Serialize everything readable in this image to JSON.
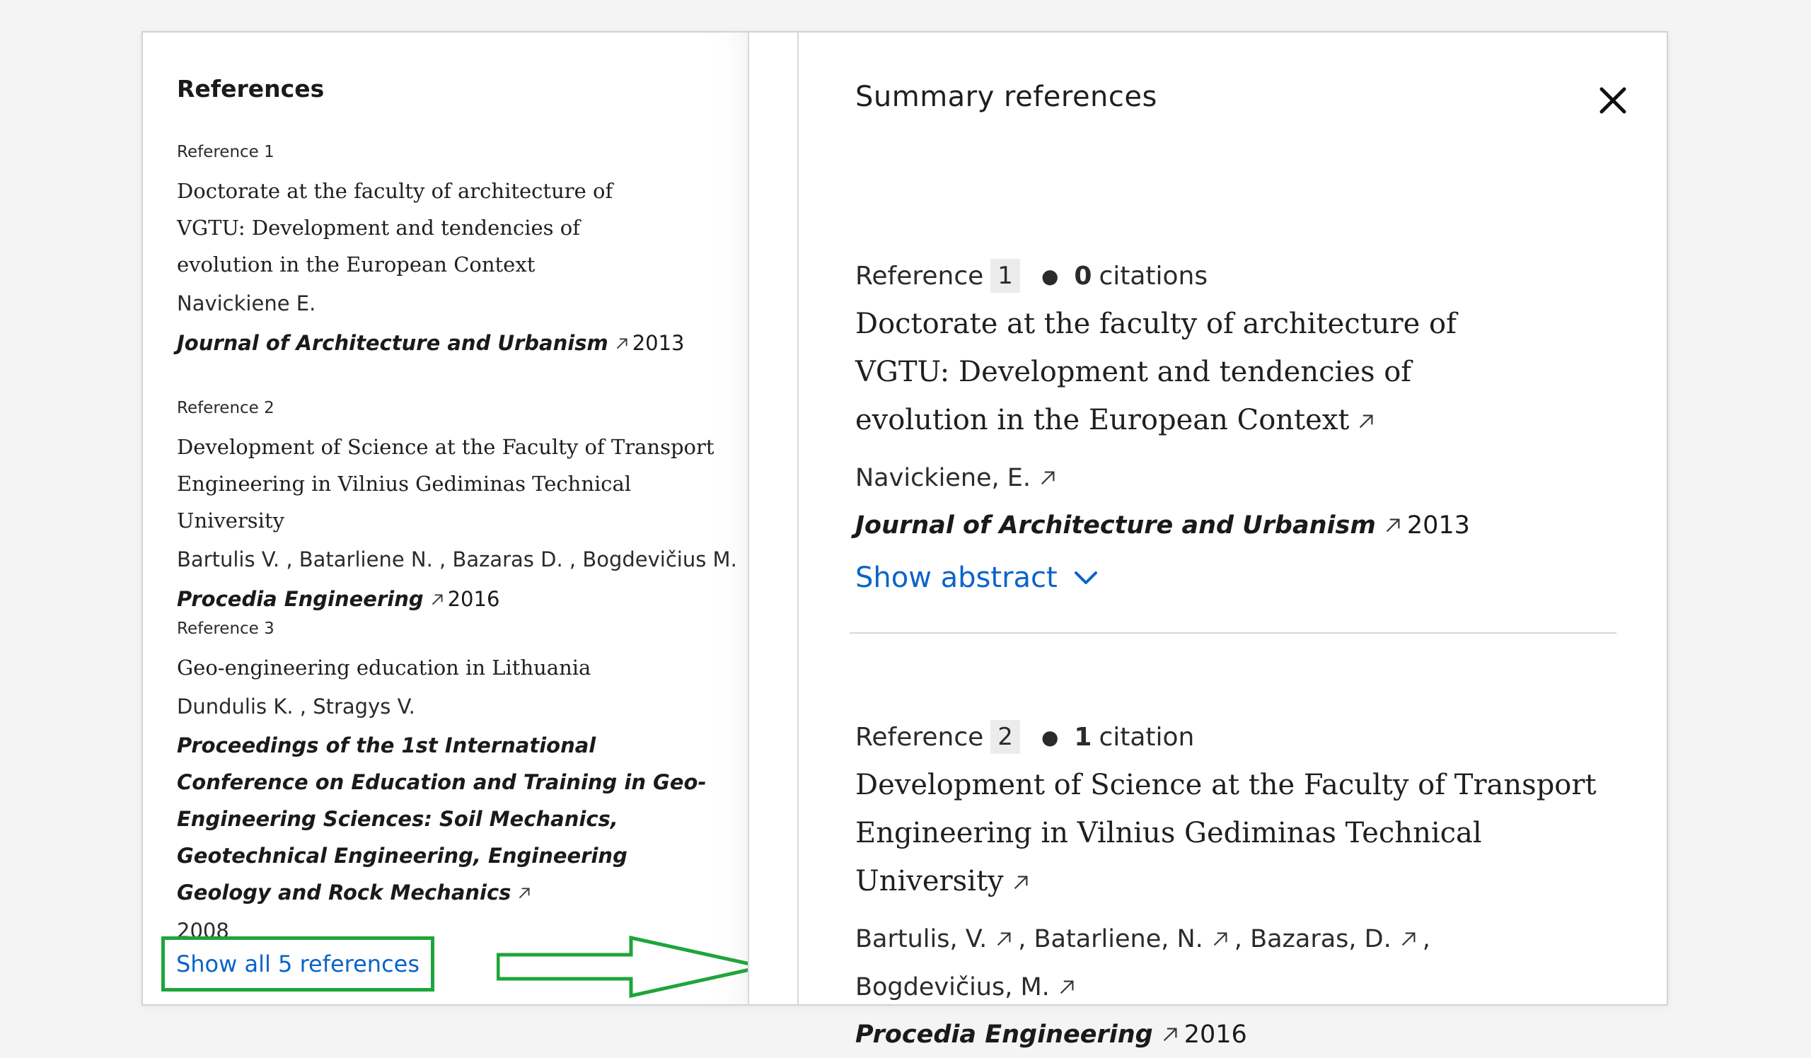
{
  "left_panel": {
    "title": "References",
    "refs": [
      {
        "label": "Reference 1",
        "title": "Doctorate at the faculty of architecture of VGTU: Development and tendencies of evolution in the European Context",
        "authors": "Navickiene E.",
        "journal": "Journal of Architecture and Urbanism",
        "year": "2013"
      },
      {
        "label": "Reference 2",
        "title": "Development of Science at the Faculty of Transport Engineering in Vilnius Gediminas Technical University",
        "authors": "Bartulis V. , Batarliene N. , Bazaras D. , Bogdevičius M.",
        "journal": "Procedia Engineering",
        "year": "2016"
      },
      {
        "label": "Reference 3",
        "title": "Geo-engineering education in Lithuania",
        "authors": "Dundulis K. , Stragys V.",
        "journal": "Proceedings of the 1st International Conference on Education and Training in Geo-Engineering Sciences: Soil Mechanics, Geotechnical Engineering, Engineering Geology and Rock Mechanics",
        "year": "2008"
      }
    ],
    "show_all_label": "Show all 5 references"
  },
  "right_panel": {
    "title": "Summary references",
    "refs": [
      {
        "label": "Reference",
        "number": "1",
        "citations_count": "0",
        "citations_word": "citations",
        "title": "Doctorate at the faculty of architecture of VGTU: Development and tendencies of evolution in the European Context",
        "authors_line1": "Navickiene, E.",
        "journal": "Journal of Architecture and Urbanism",
        "year": "2013",
        "show_abstract": "Show abstract"
      },
      {
        "label": "Reference",
        "number": "2",
        "citations_count": "1",
        "citations_word": "citation",
        "title": "Development of Science at the Faculty of Transport Engineering in Vilnius Gediminas Technical University",
        "authors": [
          "Bartulis, V.",
          "Batarliene, N.",
          "Bazaras, D.",
          "Bogdevičius, M."
        ],
        "journal": "Procedia Engineering",
        "year": "2016"
      }
    ]
  },
  "colors": {
    "link": "#0a64c8",
    "highlight_box": "#1ea53a",
    "arrow": "#1ea53a"
  }
}
